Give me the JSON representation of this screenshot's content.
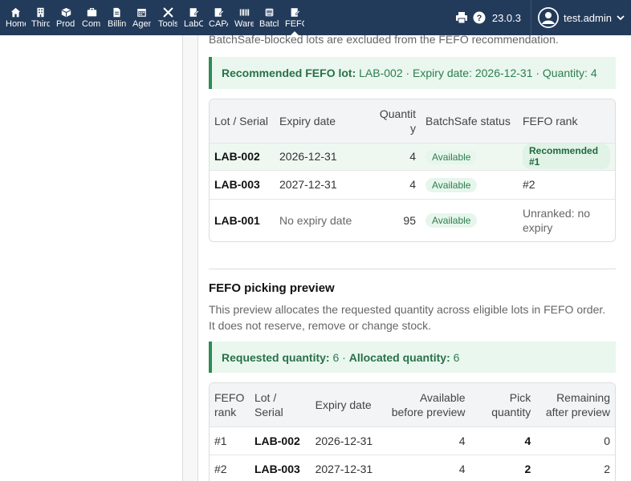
{
  "nav": {
    "items": [
      {
        "label": "Home",
        "icon": "home-icon"
      },
      {
        "label": "Third",
        "icon": "building-icon"
      },
      {
        "label": "Prod",
        "icon": "cube-icon"
      },
      {
        "label": "Com",
        "icon": "briefcase-icon"
      },
      {
        "label": "Billin",
        "icon": "invoice-icon"
      },
      {
        "label": "Agen",
        "icon": "calendar-icon"
      },
      {
        "label": "Tools",
        "icon": "tools-icon"
      },
      {
        "label": "LabC",
        "icon": "doc-edit-icon"
      },
      {
        "label": "CAPA",
        "icon": "doc-edit-icon"
      },
      {
        "label": "Ware",
        "icon": "barcode-icon"
      },
      {
        "label": "Batcl",
        "icon": "tag-icon"
      },
      {
        "label": "FEFO",
        "icon": "doc-edit-icon"
      }
    ],
    "version": "23.0.3",
    "username": "test.admin"
  },
  "top": {
    "note": "BatchSafe-blocked lots are excluded from the FEFO recommendation.",
    "recommendation": {
      "label": "Recommended FEFO lot:",
      "text": "LAB-002 · Expiry date: 2026-12-31 · Quantity: 4"
    }
  },
  "lots_table": {
    "headers": [
      "Lot / Serial",
      "Expiry date",
      "Quantity",
      "BatchSafe status",
      "FEFO rank"
    ],
    "rows": [
      {
        "lot": "LAB-002",
        "expiry": "2026-12-31",
        "qty": "4",
        "status": "Available",
        "rank": "Recommended #1"
      },
      {
        "lot": "LAB-003",
        "expiry": "2027-12-31",
        "qty": "4",
        "status": "Available",
        "rank": "#2"
      },
      {
        "lot": "LAB-001",
        "expiry": "No expiry date",
        "qty": "95",
        "status": "Available",
        "rank": "Unranked: no expiry"
      }
    ]
  },
  "preview": {
    "title": "FEFO picking preview",
    "desc": "This preview allocates the requested quantity across eligible lots in FEFO order. It does not reserve, remove or change stock.",
    "requested_label": "Requested quantity:",
    "requested_value": "6",
    "allocated_label": "Allocated quantity:",
    "allocated_value": "6",
    "headers": [
      "FEFO rank",
      "Lot / Serial",
      "Expiry date",
      "Available before preview",
      "Pick quantity",
      "Remaining after preview"
    ],
    "rows": [
      {
        "rank": "#1",
        "lot": "LAB-002",
        "expiry": "2026-12-31",
        "available": "4",
        "pick": "4",
        "remaining": "0"
      },
      {
        "rank": "#2",
        "lot": "LAB-003",
        "expiry": "2027-12-31",
        "available": "4",
        "pick": "2",
        "remaining": "2"
      }
    ]
  }
}
